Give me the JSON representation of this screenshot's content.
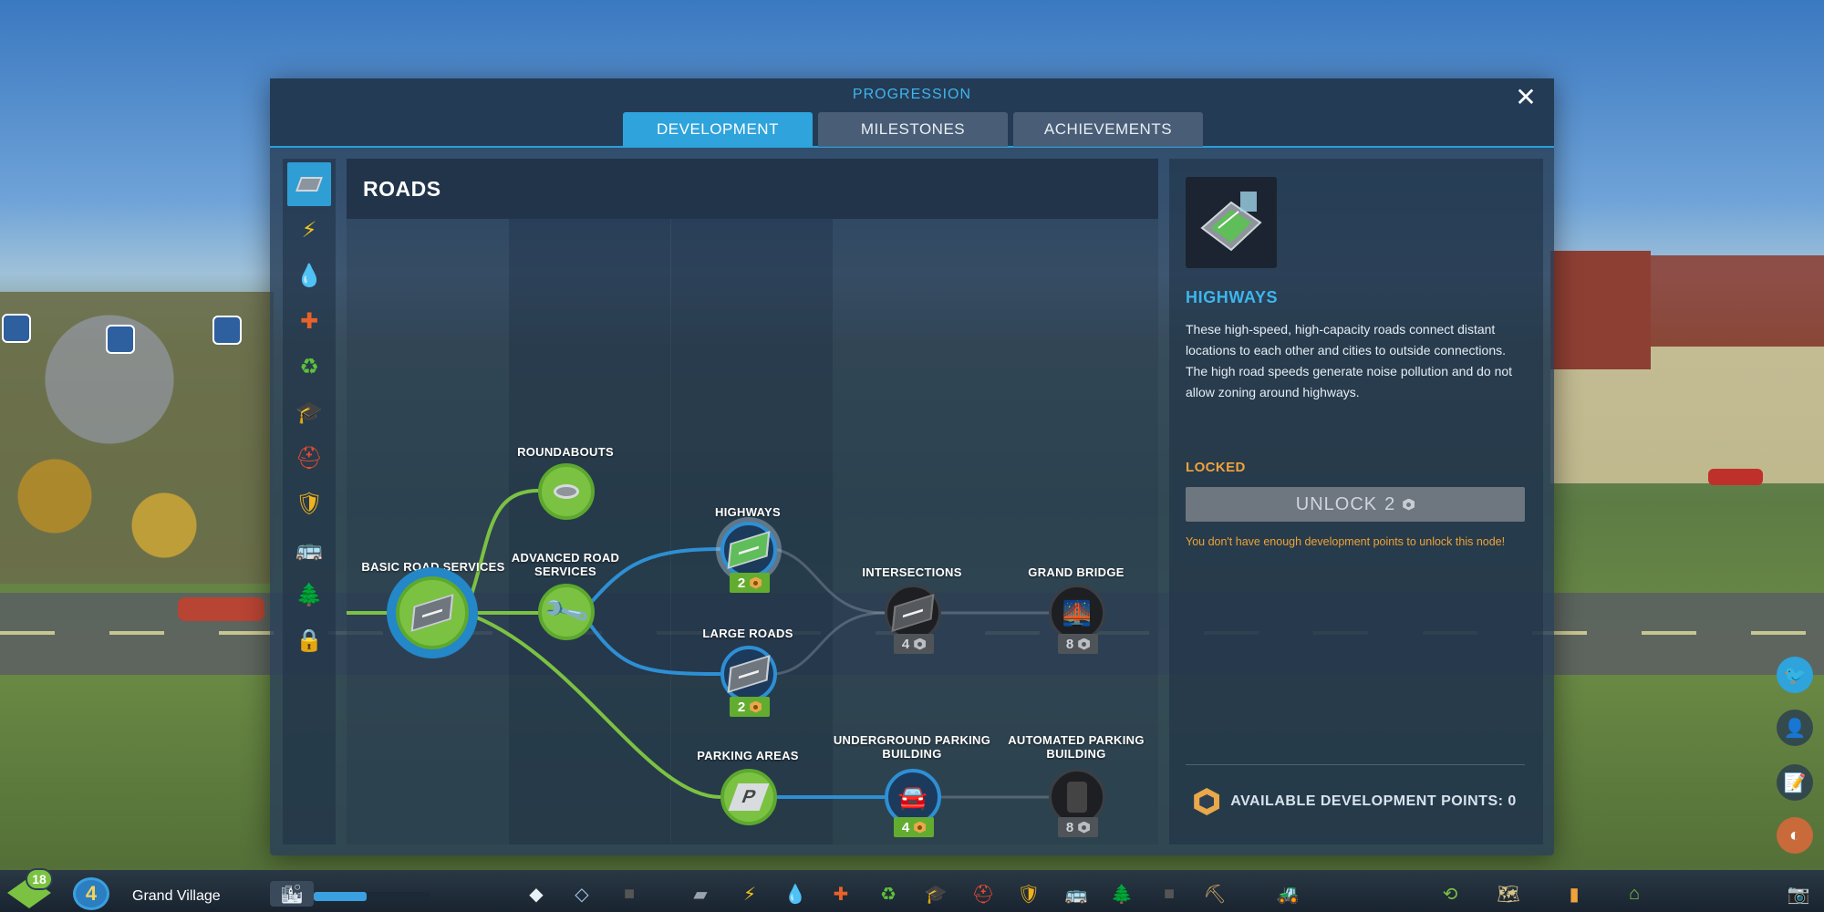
{
  "window": {
    "title": "PROGRESSION",
    "close_label": "✕"
  },
  "tabs": [
    {
      "label": "DEVELOPMENT",
      "active": true
    },
    {
      "label": "MILESTONES",
      "active": false
    },
    {
      "label": "ACHIEVEMENTS",
      "active": false
    }
  ],
  "categories": [
    {
      "name": "roads",
      "icon": "road-icon",
      "active": true
    },
    {
      "name": "electricity",
      "icon": "lightning-icon",
      "active": false
    },
    {
      "name": "water",
      "icon": "water-drop-icon",
      "active": false
    },
    {
      "name": "healthcare",
      "icon": "healthcare-icon",
      "active": false
    },
    {
      "name": "garbage",
      "icon": "recycle-icon",
      "active": false
    },
    {
      "name": "education",
      "icon": "graduation-cap-icon",
      "active": false
    },
    {
      "name": "fire",
      "icon": "fire-station-icon",
      "active": false
    },
    {
      "name": "police",
      "icon": "police-badge-icon",
      "active": false
    },
    {
      "name": "transport",
      "icon": "bus-icon",
      "active": false
    },
    {
      "name": "parks",
      "icon": "park-tree-icon",
      "active": false
    },
    {
      "name": "locked",
      "icon": "locked-category-icon",
      "active": false
    }
  ],
  "tree": {
    "title": "ROADS",
    "nodes": [
      {
        "id": "basic",
        "label": "BASIC ROAD SERVICES",
        "state": "unlocked",
        "cost": ""
      },
      {
        "id": "roundabouts",
        "label": "ROUNDABOUTS",
        "state": "unlocked",
        "cost": ""
      },
      {
        "id": "advanced",
        "label": "ADVANCED ROAD SERVICES",
        "state": "unlocked",
        "cost": ""
      },
      {
        "id": "highways",
        "label": "HIGHWAYS",
        "state": "available",
        "cost": "2"
      },
      {
        "id": "large_roads",
        "label": "LARGE ROADS",
        "state": "available",
        "cost": "2"
      },
      {
        "id": "intersections",
        "label": "INTERSECTIONS",
        "state": "locked",
        "cost": "4"
      },
      {
        "id": "grand_bridge",
        "label": "GRAND BRIDGE",
        "state": "locked",
        "cost": "8"
      },
      {
        "id": "parking_areas",
        "label": "PARKING AREAS",
        "state": "unlocked",
        "cost": ""
      },
      {
        "id": "underground_parking",
        "label": "UNDERGROUND PARKING BUILDING",
        "state": "available",
        "cost": "4"
      },
      {
        "id": "automated_parking",
        "label": "AUTOMATED PARKING BUILDING",
        "state": "locked",
        "cost": "8"
      }
    ]
  },
  "details": {
    "title": "HIGHWAYS",
    "description": "These high-speed, high-capacity roads connect distant locations to each other and cities to outside connections. The high road speeds generate noise pollution and do not allow zoning around highways.",
    "status": "LOCKED",
    "unlock_label": "UNLOCK",
    "unlock_cost": "2",
    "warning": "You don't have enough development points to unlock this node!",
    "points_label": "AVAILABLE DEVELOPMENT POINTS: 0"
  },
  "bottom_bar": {
    "level_badge": "18",
    "population_level": "4",
    "city_name": "Grand Village",
    "tools": [
      "zoning-icon",
      "area-icon",
      "locked-tool-icon",
      "road-tool-icon",
      "electricity-tool-icon",
      "water-tool-icon",
      "health-tool-icon",
      "garbage-tool-icon",
      "education-tool-icon",
      "fire-tool-icon",
      "police-tool-icon",
      "transport-tool-icon",
      "park-tool-icon",
      "locked-tool2-icon",
      "shovel-icon",
      "bulldozer-icon",
      "traffic-icon",
      "map-icon",
      "stats-icon",
      "home-icon",
      "camera-icon"
    ]
  },
  "colors": {
    "accent": "#2ea3dc",
    "unlocked": "#7cc242",
    "locked_warning": "#f0a23a",
    "panel": "#283e58"
  }
}
